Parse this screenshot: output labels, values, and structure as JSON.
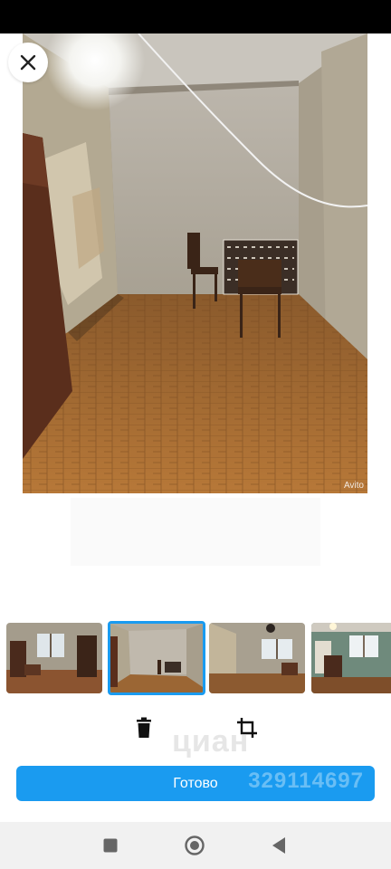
{
  "viewer": {
    "close_icon": "close-icon",
    "photo_watermark": "Avito"
  },
  "thumbnails": [
    {
      "name": "thumbnail-1",
      "selected": false
    },
    {
      "name": "thumbnail-2",
      "selected": true
    },
    {
      "name": "thumbnail-3",
      "selected": false
    },
    {
      "name": "thumbnail-4",
      "selected": false
    }
  ],
  "actions": {
    "delete_icon": "trash-icon",
    "crop_icon": "crop-icon",
    "watermark_text": "циан"
  },
  "done_button": {
    "label": "Готово",
    "watermark_id": "329114697"
  },
  "nav": {
    "recents_icon": "square-icon",
    "home_icon": "circle-icon",
    "back_icon": "back-triangle-icon"
  },
  "colors": {
    "accent": "#1a9bf0",
    "status_bar": "#000000",
    "nav_bar": "#f1f1f1"
  }
}
